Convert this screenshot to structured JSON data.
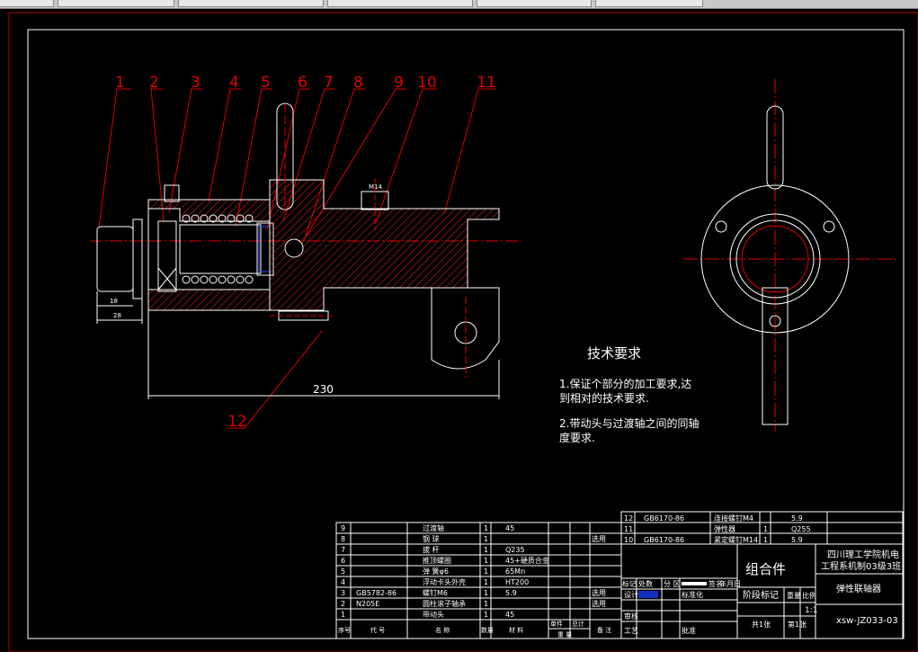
{
  "window": {
    "tabs": [
      "",
      "",
      "",
      "",
      "",
      ""
    ]
  },
  "drawing": {
    "balloons": [
      "1",
      "2",
      "3",
      "4",
      "5",
      "6",
      "7",
      "8",
      "9",
      "10",
      "11",
      "12"
    ],
    "dim_230": "230",
    "dim_28": "28",
    "dim_18": "18",
    "bolt_label": "M14",
    "tech_title": "技术要求",
    "tech_1a": "1.保证个部分的加工要求,达",
    "tech_1b": "到相对的技术要求.",
    "tech_2a": "2.带动头与过渡轴之间的同轴",
    "tech_2b": "度要求."
  },
  "bom_upper": [
    {
      "no": "12",
      "code": "GB6170-86",
      "name": "连接螺钉M4",
      "qty": "",
      "mat": "5.9"
    },
    {
      "no": "11",
      "code": "",
      "name": "弹性器",
      "qty": "1",
      "mat": "Q255"
    },
    {
      "no": "10",
      "code": "GB6170-86",
      "name": "紧定螺钉M14",
      "qty": "1",
      "mat": "5.9"
    }
  ],
  "bom_lower": [
    {
      "no": "9",
      "code": "",
      "name": "过渡轴",
      "qty": "1",
      "mat": "45",
      "note": ""
    },
    {
      "no": "8",
      "code": "",
      "name": "钢 球",
      "qty": "1",
      "mat": "",
      "note": "选用"
    },
    {
      "no": "7",
      "code": "",
      "name": "拔 杆",
      "qty": "1",
      "mat": "Q235",
      "note": ""
    },
    {
      "no": "6",
      "code": "",
      "name": "推顶螺圈",
      "qty": "1",
      "mat": "45+硬质合金",
      "note": ""
    },
    {
      "no": "5",
      "code": "",
      "name": "弹 簧φ6",
      "qty": "1",
      "mat": "65Mn",
      "note": ""
    },
    {
      "no": "4",
      "code": "",
      "name": "浮动卡头外壳",
      "qty": "1",
      "mat": "HT200",
      "note": ""
    },
    {
      "no": "3",
      "code": "GB5782-86",
      "name": "螺钉M6",
      "qty": "1",
      "mat": "5.9",
      "note": "选用"
    },
    {
      "no": "2",
      "code": "N205E",
      "name": "圆柱滚子轴承",
      "qty": "1",
      "mat": "",
      "note": "选用"
    },
    {
      "no": "1",
      "code": "",
      "name": "带动头",
      "qty": "1",
      "mat": "45",
      "note": ""
    }
  ],
  "bom_header": {
    "no": "序号",
    "code": "代 号",
    "name": "名 称",
    "qty": "数量",
    "mat": "材 料",
    "unit_wt": "单件",
    "total_wt": "总计",
    "weight": "重 量",
    "note": "备 注"
  },
  "title_block": {
    "assembly": "组合件",
    "school": "四川理工学院机电",
    "class": "工程系机制03级3班",
    "part_name": "弹性联轴器",
    "drawing_no": "xsw-JZ033-03",
    "scale": "1:1",
    "stage": "阶段标记",
    "weight_lbl": "重量",
    "scale_lbl": "比例",
    "sheets_total": "共1张",
    "sheet_no": "第1张",
    "rev_mark": "标记",
    "rev_qty": "处数",
    "rev_zone": "分 区",
    "rev_sign": "签名",
    "rev_date": "年月日",
    "design": "设计",
    "standard": "标准化",
    "check": "审核",
    "process": "工艺",
    "approve": "批准"
  }
}
